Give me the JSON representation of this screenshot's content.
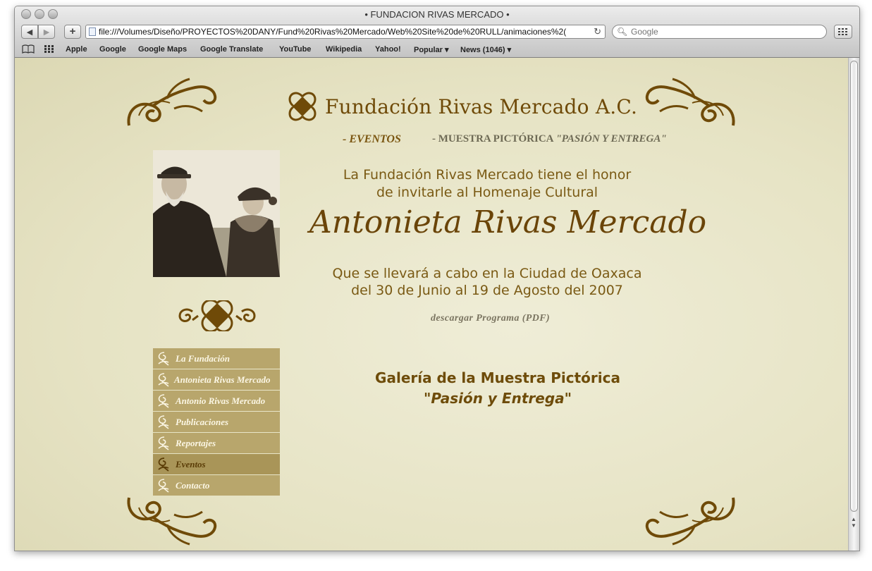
{
  "window": {
    "title": "• FUNDACION RIVAS MERCADO •"
  },
  "toolbar": {
    "back": "◀",
    "forward": "▶",
    "add": "+",
    "url": "file:///Volumes/Diseño/PROYECTOS%20DANY/Fund%20Rivas%20Mercado/Web%20Site%20de%20RULL/animaciones%2(",
    "search_placeholder": "Google"
  },
  "bookmarks": [
    "Apple",
    "Google",
    "Google Maps",
    "Google Translate",
    "YouTube",
    "Wikipedia",
    "Yahoo!",
    "Popular ▾",
    "News (1046) ▾"
  ],
  "page": {
    "logo_text": "Fundación Rivas Mercado A.C.",
    "breadcrumb_section": "- EVENTOS",
    "breadcrumb_event_prefix": "- MUESTRA PICTÓRICA",
    "breadcrumb_event_title": "\"PASIÓN Y ENTREGA\"",
    "intro_line1": "La Fundación Rivas Mercado tiene el honor",
    "intro_line2": "de invitarle al  Homenaje Cultural",
    "honoree": "Antonieta Rivas Mercado",
    "details_line1": "Que se llevará a cabo en la Ciudad de Oaxaca",
    "details_line2": "del 30 de Junio al 19 de Agosto del 2007",
    "download_link": "descargar Programa (PDF)",
    "gallery_title": "Galería de la Muestra Pictórica",
    "gallery_subtitle": "\"Pasión y Entrega\""
  },
  "menu": [
    {
      "label": "La Fundación",
      "active": false
    },
    {
      "label": "Antonieta Rivas Mercado",
      "active": false
    },
    {
      "label": "Antonio Rivas Mercado",
      "active": false
    },
    {
      "label": "Publicaciones",
      "active": false
    },
    {
      "label": "Reportajes",
      "active": false
    },
    {
      "label": "Eventos",
      "active": true
    },
    {
      "label": "Contacto",
      "active": false
    }
  ],
  "colors": {
    "brand_brown": "#6f4a08",
    "menu_bg": "#b8a66c",
    "page_bg": "#e9e6c8"
  }
}
